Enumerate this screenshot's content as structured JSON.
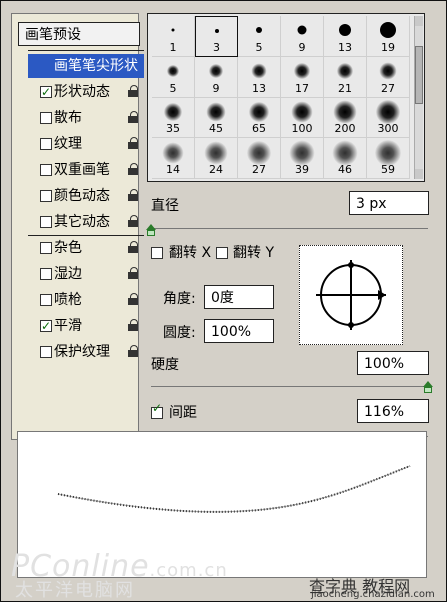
{
  "left_panel": {
    "preset_label": "画笔预设",
    "items": [
      {
        "label": "画笔笔尖形状",
        "selected": true,
        "checked": false,
        "checkbox": false,
        "locked": false
      },
      {
        "label": "形状动态",
        "selected": false,
        "checked": true,
        "checkbox": true,
        "locked": true
      },
      {
        "label": "散布",
        "selected": false,
        "checked": false,
        "checkbox": true,
        "locked": true
      },
      {
        "label": "纹理",
        "selected": false,
        "checked": false,
        "checkbox": true,
        "locked": true
      },
      {
        "label": "双重画笔",
        "selected": false,
        "checked": false,
        "checkbox": true,
        "locked": true
      },
      {
        "label": "颜色动态",
        "selected": false,
        "checked": false,
        "checkbox": true,
        "locked": true
      },
      {
        "label": "其它动态",
        "selected": false,
        "checked": false,
        "checkbox": true,
        "locked": true
      },
      {
        "label": "杂色",
        "selected": false,
        "checked": false,
        "checkbox": true,
        "locked": true
      },
      {
        "label": "湿边",
        "selected": false,
        "checked": false,
        "checkbox": true,
        "locked": true
      },
      {
        "label": "喷枪",
        "selected": false,
        "checked": false,
        "checkbox": true,
        "locked": true
      },
      {
        "label": "平滑",
        "selected": false,
        "checked": true,
        "checkbox": true,
        "locked": true
      },
      {
        "label": "保护纹理",
        "selected": false,
        "checked": false,
        "checkbox": true,
        "locked": true
      }
    ]
  },
  "brushes": {
    "rows": [
      [
        {
          "size": "1",
          "kind": "hard",
          "selected": false
        },
        {
          "size": "3",
          "kind": "hard",
          "selected": true
        },
        {
          "size": "5",
          "kind": "hard",
          "selected": false
        },
        {
          "size": "9",
          "kind": "hard",
          "selected": false
        },
        {
          "size": "13",
          "kind": "hard",
          "selected": false
        },
        {
          "size": "19",
          "kind": "hard",
          "selected": false
        }
      ],
      [
        {
          "size": "5",
          "kind": "soft",
          "selected": false
        },
        {
          "size": "9",
          "kind": "soft",
          "selected": false
        },
        {
          "size": "13",
          "kind": "soft",
          "selected": false
        },
        {
          "size": "17",
          "kind": "soft",
          "selected": false
        },
        {
          "size": "21",
          "kind": "soft",
          "selected": false
        },
        {
          "size": "27",
          "kind": "soft",
          "selected": false
        }
      ],
      [
        {
          "size": "35",
          "kind": "soft",
          "selected": false
        },
        {
          "size": "45",
          "kind": "soft",
          "selected": false
        },
        {
          "size": "65",
          "kind": "soft",
          "selected": false
        },
        {
          "size": "100",
          "kind": "soft",
          "selected": false
        },
        {
          "size": "200",
          "kind": "soft",
          "selected": false
        },
        {
          "size": "300",
          "kind": "soft",
          "selected": false
        }
      ],
      [
        {
          "size": "14",
          "kind": "spray",
          "selected": false
        },
        {
          "size": "24",
          "kind": "spray",
          "selected": false
        },
        {
          "size": "27",
          "kind": "spray",
          "selected": false
        },
        {
          "size": "39",
          "kind": "spray",
          "selected": false
        },
        {
          "size": "46",
          "kind": "spray",
          "selected": false
        },
        {
          "size": "59",
          "kind": "spray",
          "selected": false
        }
      ]
    ]
  },
  "diameter": {
    "label": "直径",
    "value": "3 px",
    "slider_fraction": 0.0
  },
  "flip": {
    "x_label": "翻转 X",
    "y_label": "翻转 Y",
    "x_checked": false,
    "y_checked": false
  },
  "angle": {
    "label": "角度:",
    "value": "0度"
  },
  "roundness": {
    "label": "圆度:",
    "value": "100%"
  },
  "hardness": {
    "label": "硬度",
    "value": "100%",
    "slider_fraction": 1.0
  },
  "spacing": {
    "label": "间距",
    "value": "116%",
    "checked": true,
    "slider_fraction": 0.55
  },
  "watermarks": {
    "left_main": "PConline",
    "left_suffix": ".com.cn",
    "left_cn": "太平洋电脑网",
    "right_main": "查字典 教程网",
    "right_small": "jiaocheng.chazidian.com"
  },
  "colors": {
    "selection": "#2b59c3",
    "slider_handle": "#2a7b2a",
    "panel_bg": "#d4d0c8"
  }
}
